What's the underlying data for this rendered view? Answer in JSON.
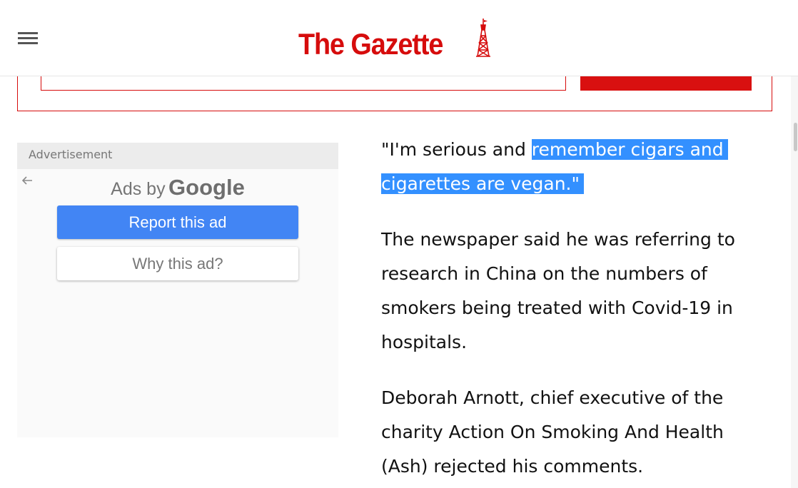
{
  "header": {
    "site_name": "The Gazette",
    "menu_icon": "hamburger-menu-icon",
    "logo_icon": "tower-icon",
    "brand_color": "#d60c0c"
  },
  "ad": {
    "label": "Advertisement",
    "ads_by_prefix": "Ads by",
    "ads_by_brand": "Google",
    "report_label": "Report this ad",
    "why_label": "Why this ad?",
    "back_icon": "back-arrow-icon",
    "accent_color": "#4285f4"
  },
  "article": {
    "quote_plain": "\"I'm serious and ",
    "quote_selected_1": "remember cigars and",
    "quote_selected_2": "cigarettes are vegan.\"",
    "selection_color": "#3390ff",
    "paragraph_2": "The newspaper said he was referring to research in China on the numbers of smokers being treated with Covid-19 in hospitals.",
    "paragraph_3": "Deborah Arnott, chief executive of the charity Action On Smoking And Health (Ash) rejected his comments."
  }
}
